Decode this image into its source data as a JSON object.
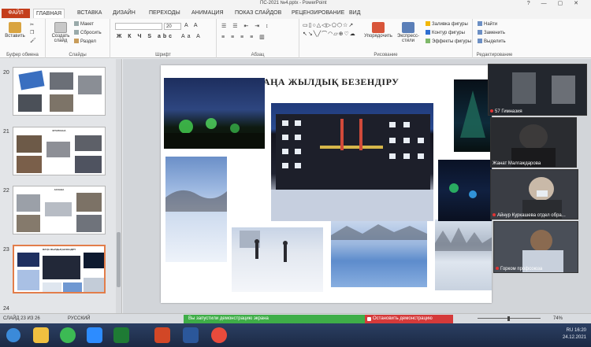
{
  "window": {
    "title": "ПС-2021 №4.pptx - PowerPoint",
    "controls": "?  —  ▢  ✕"
  },
  "tabs": [
    {
      "label": "ФАЙЛ"
    },
    {
      "label": "ГЛАВНАЯ"
    },
    {
      "label": "ВСТАВКА"
    },
    {
      "label": "ДИЗАЙН"
    },
    {
      "label": "ПЕРЕХОДЫ"
    },
    {
      "label": "АНИМАЦИЯ"
    },
    {
      "label": "ПОКАЗ СЛАЙДОВ"
    },
    {
      "label": "РЕЦЕНЗИРОВАНИЕ"
    },
    {
      "label": "ВИД"
    }
  ],
  "ribbon": {
    "clipboard": {
      "paste": "Вставить",
      "group": "Буфер обмена"
    },
    "slides": {
      "new_slide": "Создать слайд",
      "layout": "Макет",
      "reset": "Сбросить",
      "section": "Раздел",
      "group": "Слайды"
    },
    "font": {
      "font_size": "20",
      "group": "Шрифт"
    },
    "paragraph": {
      "group": "Абзац"
    },
    "drawing": {
      "arrange": "Упорядочить",
      "quick_styles": "Экспресс-стили",
      "fill": "Заливка фигуры",
      "outline": "Контур фигуры",
      "effects": "Эффекты фигуры",
      "group": "Рисование"
    },
    "editing": {
      "find": "Найти",
      "replace": "Заменить",
      "select": "Выделить",
      "group": "Редактирование"
    }
  },
  "thumbnails": [
    {
      "number": "20",
      "title": ""
    },
    {
      "number": "21",
      "title": "КІТАПХАНА"
    },
    {
      "number": "22",
      "title": "АСХАНА"
    },
    {
      "number": "23",
      "title": "ЖАҢА ЖЫЛДЫҚ БЕЗЕНДІРУ"
    },
    {
      "number": "24",
      "title": ""
    }
  ],
  "slide": {
    "title": "ЖАҢА ЖЫЛДЫҚ БЕЗЕНДІРУ"
  },
  "video_tiles": [
    {
      "name": "57 Гимназия"
    },
    {
      "name": "Жанат Малгаждарова"
    },
    {
      "name": "Айнур Куркашева отдел обра..."
    },
    {
      "name": "Горком профсоюза"
    }
  ],
  "status": {
    "slide_counter": "СЛАЙД 23 ИЗ 26",
    "language": "РУССКИЙ",
    "share_notice": "Вы запустили демонстрацию экрана",
    "stop_button": "Остановить демонстрацию",
    "zoom": "74%"
  },
  "taskbar": {
    "time": "16:20",
    "date": "24.12.2021",
    "lang": "RU"
  },
  "colors": {
    "file_tab": "#c43e1c",
    "share_bar": "#3fae48",
    "stop_button": "#d53a3a",
    "selected_thumb": "#e27d4a"
  }
}
